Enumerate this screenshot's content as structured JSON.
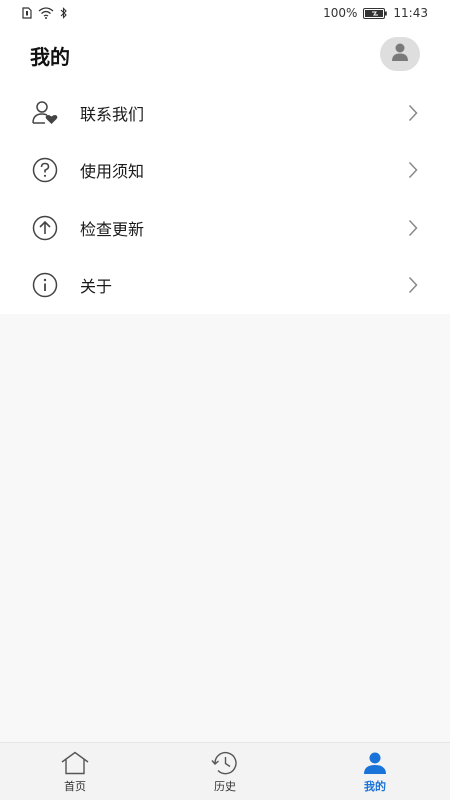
{
  "status_bar": {
    "battery": "100%",
    "time": "11:43"
  },
  "header": {
    "title": "我的"
  },
  "menu": {
    "items": [
      {
        "label": "联系我们",
        "icon": "contact-heart-icon"
      },
      {
        "label": "使用须知",
        "icon": "question-icon"
      },
      {
        "label": "检查更新",
        "icon": "upload-arrow-icon"
      },
      {
        "label": "关于",
        "icon": "info-icon"
      }
    ]
  },
  "bottom_nav": {
    "tabs": [
      {
        "label": "首页",
        "icon": "home-icon"
      },
      {
        "label": "历史",
        "icon": "clock-icon"
      },
      {
        "label": "我的",
        "icon": "person-icon",
        "active": true
      }
    ]
  },
  "colors": {
    "accent": "#1a73d9",
    "background": "#f8f8f8",
    "card": "#ffffff"
  }
}
